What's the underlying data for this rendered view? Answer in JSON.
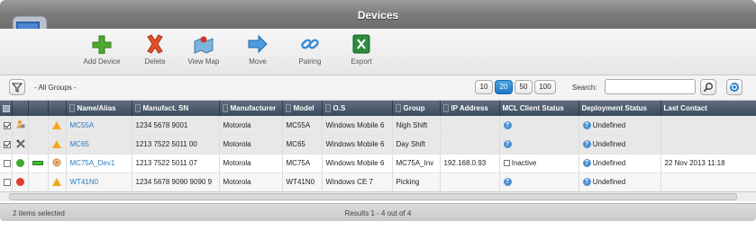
{
  "window": {
    "title": "Devices"
  },
  "toolbar": [
    {
      "label": "Add Device",
      "icon": "plus-icon"
    },
    {
      "label": "Delete",
      "icon": "x-icon"
    },
    {
      "label": "View Map",
      "icon": "map-icon"
    },
    {
      "label": "Move",
      "icon": "arrow-right-icon"
    },
    {
      "label": "Pairing",
      "icon": "link-icon"
    },
    {
      "label": "Export",
      "icon": "excel-icon"
    }
  ],
  "filter": {
    "group_label": "- All Groups -",
    "page_sizes": [
      "10",
      "20",
      "50",
      "100"
    ],
    "active_page_size": "20",
    "search_label": "Search:",
    "search_value": ""
  },
  "columns": [
    "Name/Alias",
    "Manufact. SN",
    "Manufacturer",
    "Model",
    "O.S",
    "Group",
    "IP Address",
    "MCL Client Status",
    "Deployment Status",
    "Last Contact"
  ],
  "rows": [
    {
      "checked": true,
      "status_icon": "user-lock-icon",
      "name": "MC55A",
      "sn": "1234 5678 9001",
      "manufacturer": "Motorola",
      "model": "MC55A",
      "os": "Windows Mobile 6",
      "group": "Nigh Shift",
      "ip": "",
      "mcl": "",
      "deployment": "Undefined",
      "last_contact": ""
    },
    {
      "checked": true,
      "status_icon": "tools-icon",
      "name": "MC65",
      "sn": "1213 7522 5011 00",
      "manufacturer": "Motorola",
      "model": "MC65",
      "os": "Windows Mobile 6",
      "group": "Day Shift",
      "ip": "",
      "mcl": "",
      "deployment": "Undefined",
      "last_contact": ""
    },
    {
      "checked": false,
      "status_icon": "green-check-icon",
      "name": "MC75A_Dev1",
      "sn": "1213 7522 5011 07",
      "manufacturer": "Motorola",
      "model": "MC75A",
      "os": "Windows Mobile 6",
      "group": "MC75A_Inv",
      "ip": "192.168.0.93",
      "mcl": "Inactive",
      "deployment": "Undefined",
      "last_contact": "22 Nov 2013 11:18"
    },
    {
      "checked": false,
      "status_icon": "red-minus-icon",
      "name": "WT41N0",
      "sn": "1234 5678 9090 9090 9",
      "manufacturer": "Motorola",
      "model": "WT41N0",
      "os": "Windows CE 7",
      "group": "Picking",
      "ip": "",
      "mcl": "",
      "deployment": "Undefined",
      "last_contact": ""
    }
  ],
  "status": {
    "selected_text": "2 items selected",
    "results_text": "Results 1 - 4 out of 4"
  },
  "colors": {
    "accent": "#1d79c6",
    "header_bg": "#3b4a5b",
    "link": "#2a7bc0"
  }
}
